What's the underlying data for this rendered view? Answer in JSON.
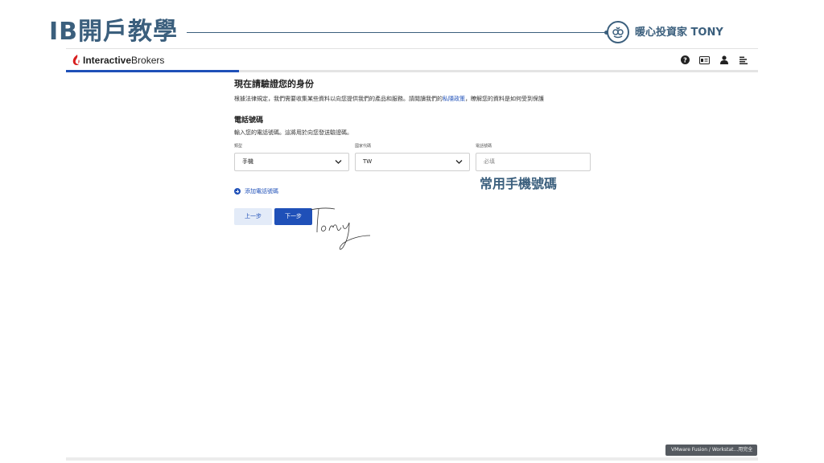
{
  "slide": {
    "title": "IB開戶教學",
    "brand_name": "暖心投資家 TONY"
  },
  "ib": {
    "logo_bold": "Interactive",
    "logo_regular": "Brokers",
    "header_icons": [
      "help-icon",
      "id-card-icon",
      "user-icon",
      "menu-icon"
    ],
    "progress_fraction": 0.25
  },
  "form": {
    "heading": "現在請驗證您的身份",
    "description_before": "根據法律規定，我們需要收集某些資料以向您提供我們的產品和服務。請閱讀我們的",
    "description_link": "私隱政策",
    "description_after": "，瞭解您的資料是如何受到保護",
    "section_title": "電話號碼",
    "section_desc": "輸入您的電話號碼。這將用於向您發送驗證碼。",
    "fields": {
      "type_label": "類型",
      "type_value": "手機",
      "country_label": "國家代碼",
      "country_value": "TW",
      "phone_label": "電話號碼",
      "phone_placeholder": "必填"
    },
    "add_phone": "添加電話號碼",
    "back_button": "上一步",
    "next_button": "下一步"
  },
  "annotation": "常用手機號碼",
  "taskbar_tooltip": "VMware Fusion / Workstat...用完全",
  "colors": {
    "brand_blue": "#3b5f7d",
    "ib_blue": "#1f50b8"
  }
}
